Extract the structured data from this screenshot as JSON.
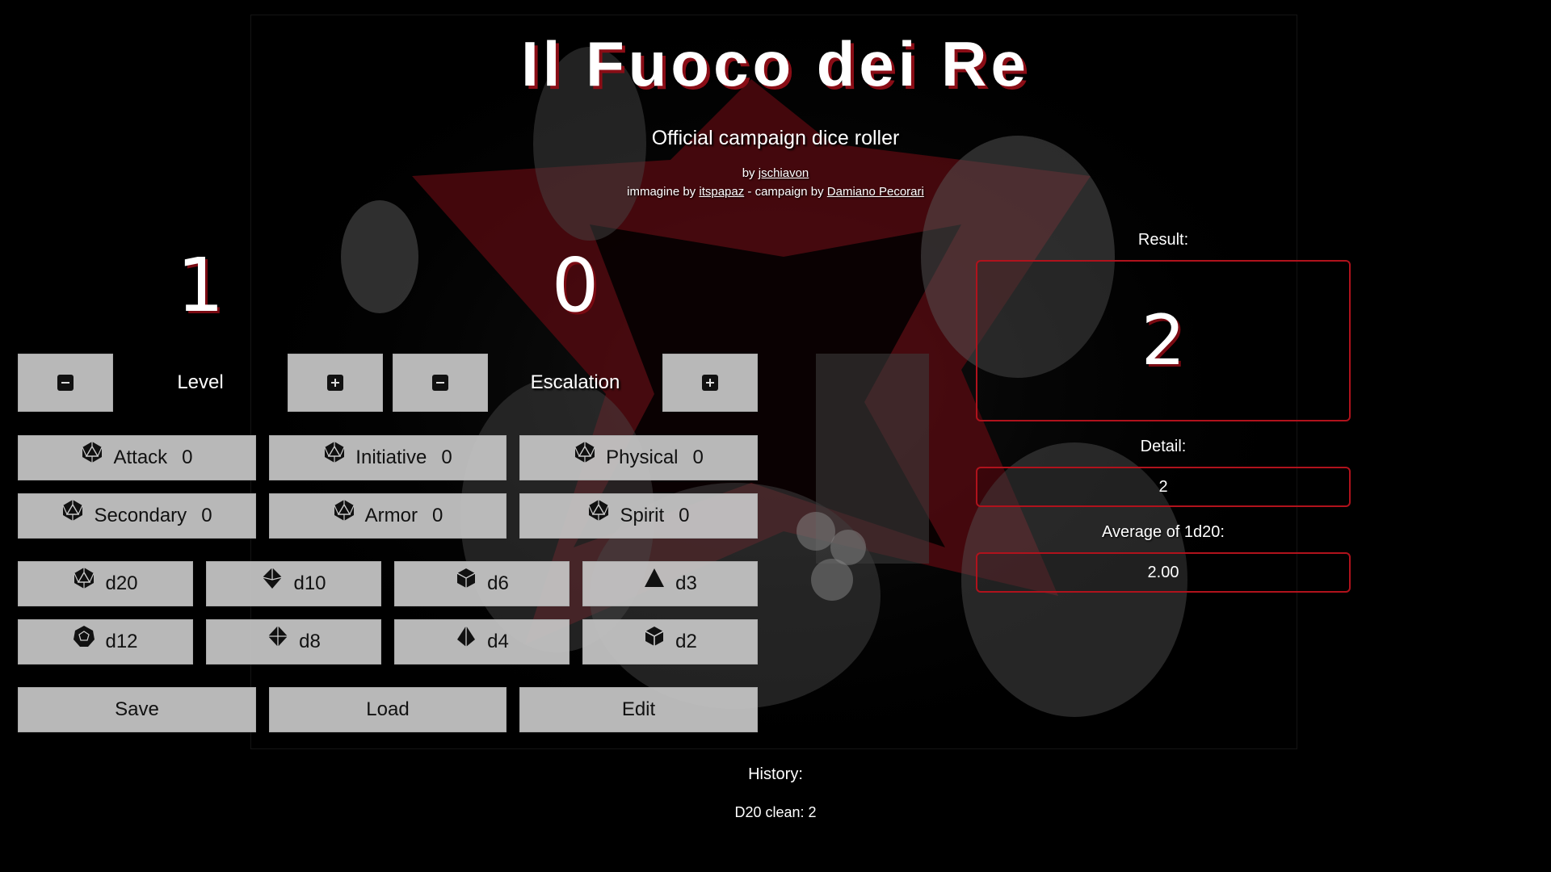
{
  "header": {
    "title": "Il Fuoco dei Re",
    "subtitle": "Official campaign dice roller",
    "by_prefix": "by",
    "author": "jschiavon",
    "image_prefix": "immagine by",
    "image_author": "itspapaz",
    "campaign_prefix": "- campaign by",
    "campaign_author": "Damiano Pecorari"
  },
  "counters": {
    "level": {
      "value": "1",
      "label": "Level"
    },
    "escalation": {
      "value": "0",
      "label": "Escalation"
    }
  },
  "stats": [
    {
      "label": "Attack",
      "value": "0"
    },
    {
      "label": "Initiative",
      "value": "0"
    },
    {
      "label": "Physical",
      "value": "0"
    },
    {
      "label": "Secondary",
      "value": "0"
    },
    {
      "label": "Armor",
      "value": "0"
    },
    {
      "label": "Spirit",
      "value": "0"
    }
  ],
  "dice": [
    {
      "label": "d20",
      "icon": "d20-icon"
    },
    {
      "label": "d10",
      "icon": "d10-icon"
    },
    {
      "label": "d6",
      "icon": "d6-icon"
    },
    {
      "label": "d3",
      "icon": "d3-icon"
    },
    {
      "label": "d12",
      "icon": "d12-icon"
    },
    {
      "label": "d8",
      "icon": "d8-icon"
    },
    {
      "label": "d4",
      "icon": "d4-icon"
    },
    {
      "label": "d2",
      "icon": "d2-icon"
    }
  ],
  "actions": {
    "save": "Save",
    "load": "Load",
    "edit": "Edit"
  },
  "results": {
    "result_label": "Result:",
    "result_value": "2",
    "detail_label": "Detail:",
    "detail_value": "2",
    "average_label": "Average of 1d20:",
    "average_value": "2.00"
  },
  "history": {
    "label": "History:",
    "entries": [
      "D20 clean: 2"
    ]
  },
  "colors": {
    "accent": "#b0121c",
    "button_bg": "#c6c6c6",
    "background": "#000000"
  }
}
